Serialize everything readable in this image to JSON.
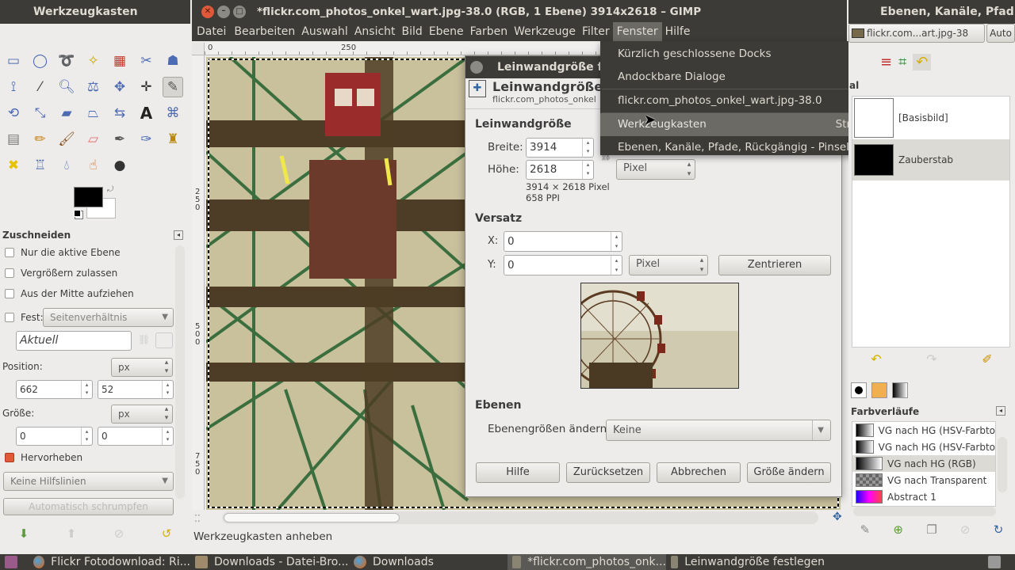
{
  "toolbox": {
    "title": "Werkzeugkasten",
    "tool_options_title": "Zuschneiden",
    "only_active_layer": "Nur die aktive Ebene",
    "allow_grow": "Vergrößern zulassen",
    "expand_center": "Aus der Mitte aufziehen",
    "fixed": "Fest:",
    "fixed_value": "Seitenverhältnis",
    "aspect_value": "Aktuell",
    "position_label": "Position:",
    "position_unit": "px",
    "pos_x": "662",
    "pos_y": "52",
    "size_label": "Größe:",
    "size_unit": "px",
    "size_w": "0",
    "size_h": "0",
    "highlight": "Hervorheben",
    "guides": "Keine Hilfslinien",
    "auto_shrink": "Automatisch schrumpfen"
  },
  "image_window": {
    "title": "*flickr.com_photos_onkel_wart.jpg-38.0 (RGB, 1 Ebene) 3914x2618 – GIMP",
    "menu": [
      "Datei",
      "Bearbeiten",
      "Auswahl",
      "Ansicht",
      "Bild",
      "Ebene",
      "Farben",
      "Werkzeuge",
      "Filter",
      "Fenster",
      "Hilfe"
    ],
    "ruler_top": [
      "0",
      "250"
    ],
    "ruler_left": [
      "2",
      "5",
      "0",
      "5",
      "0",
      "0",
      "7",
      "5",
      "0"
    ],
    "status": "Werkzeugkasten anheben"
  },
  "fenster_menu": {
    "items": [
      {
        "label": "Kürzlich geschlossene Docks",
        "arrow": "▸",
        "shortcut": ""
      },
      {
        "label": "Andockbare Dialoge",
        "arrow": "▸",
        "shortcut": ""
      },
      {
        "label": "flickr.com_photos_onkel_wart.jpg-38.0",
        "arrow": "",
        "shortcut": ""
      },
      {
        "label": "Werkzeugkasten",
        "arrow": "",
        "shortcut": "Strg+B"
      },
      {
        "label": "Ebenen, Kanäle, Pfade, Rückgängig - Pinsel, M...",
        "arrow": "",
        "shortcut": ""
      }
    ]
  },
  "dialog": {
    "title": "Leinwandgröße f",
    "header_title": "Leinwandgröße",
    "header_sub": "flickr.com_photos_onkel",
    "section_size": "Leinwandgröße",
    "width_label": "Breite:",
    "width_value": "3914",
    "height_label": "Höhe:",
    "height_value": "2618",
    "unit": "Pixel",
    "info_size": "3914 × 2618 Pixel",
    "info_ppi": "658 PPI",
    "section_offset": "Versatz",
    "x_label": "X:",
    "x_value": "0",
    "y_label": "Y:",
    "y_value": "0",
    "offset_unit": "Pixel",
    "center_button": "Zentrieren",
    "section_layers": "Ebenen",
    "resize_layers_label": "Ebenengrößen ändern",
    "resize_layers_value": "Keine",
    "btn_help": "Hilfe",
    "btn_reset": "Zurücksetzen",
    "btn_cancel": "Abbrechen",
    "btn_resize": "Größe ändern"
  },
  "layers_dock": {
    "title": "Ebenen, Kanäle, Pfad",
    "image_select": "flickr.com...art.jpg-38",
    "auto_label": "Auto",
    "mode_fragment": "al",
    "layers": [
      {
        "name": "[Basisbild]"
      },
      {
        "name": "Zauberstab"
      }
    ],
    "gradients_title": "Farbverläufe",
    "gradients": [
      "VG nach HG (HSV-Farbto",
      "VG nach HG (HSV-Farbto",
      "VG nach HG (RGB)",
      "VG nach Transparent",
      "Abstract 1"
    ]
  },
  "taskbar": {
    "items": [
      "Flickr Fotodownload: Ri...",
      "Downloads - Datei-Bro...",
      "Downloads",
      "*flickr.com_photos_onk...",
      "Leinwandgröße festlegen"
    ]
  },
  "colors": {
    "ubuntu_dark": "#3c3b37",
    "highlight": "#6b6a65",
    "accent": "#e45000"
  }
}
